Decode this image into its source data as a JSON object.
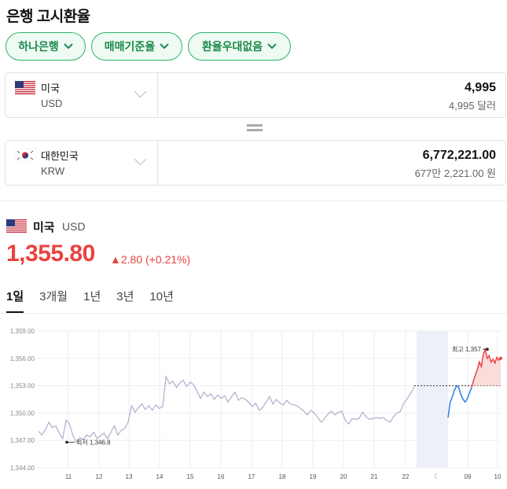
{
  "page": {
    "title": "은행 고시환율"
  },
  "filters": [
    {
      "label": "하나은행"
    },
    {
      "label": "매매기준율"
    },
    {
      "label": "환율우대없음"
    }
  ],
  "converter": {
    "from": {
      "name": "미국",
      "code": "USD",
      "amount": "4,995",
      "amount_text": "4,995 달러",
      "flag": "us-flag-icon"
    },
    "to": {
      "name": "대한민국",
      "code": "KRW",
      "amount": "6,772,221.00",
      "amount_text": "677만 2,221.00 원",
      "flag": "kr-flag-icon"
    }
  },
  "rate": {
    "country": "미국",
    "code": "USD",
    "price": "1,355.80",
    "change": "2.80 (+0.21%)",
    "up_color": "#e8423f"
  },
  "tabs": [
    {
      "label": "1일",
      "active": true
    },
    {
      "label": "3개월",
      "active": false
    },
    {
      "label": "1년",
      "active": false
    },
    {
      "label": "3년",
      "active": false
    },
    {
      "label": "10년",
      "active": false
    }
  ],
  "chart_data": {
    "type": "line",
    "ylim": [
      1344,
      1359
    ],
    "yticks": [
      "1,359.00",
      "1,356.00",
      "1,353.00",
      "1,350.00",
      "1,347.00",
      "1,344.00"
    ],
    "ytick_values": [
      1359,
      1356,
      1353,
      1350,
      1347,
      1344
    ],
    "xticks": [
      "11",
      "12",
      "13",
      "14",
      "15",
      "16",
      "17",
      "18",
      "19",
      "20",
      "21",
      "22",
      "09",
      "10"
    ],
    "baseline": 1353.0,
    "annotations": {
      "high": "최고 1,357",
      "low": "최저 1,346.8"
    },
    "series": [
      {
        "color": "#aab0cc",
        "values": [
          1348,
          1347.6,
          1348.2,
          1349,
          1348.4,
          1348.6,
          1347.8,
          1347.2,
          1349.2,
          1348.8,
          1347.5,
          1346.8,
          1347.3,
          1347.1,
          1347.6,
          1347.4,
          1347.9,
          1347.2,
          1347.5,
          1347.8,
          1347.2,
          1347.9,
          1348.6,
          1347.6,
          1348.1,
          1348.3,
          1349,
          1350.8,
          1350.1,
          1350.6,
          1351,
          1350.4,
          1350.8,
          1350.3,
          1350.9,
          1350.5,
          1350.7,
          1354,
          1353.2,
          1353.5,
          1352.8,
          1353.3,
          1353.6,
          1352.9,
          1353.4,
          1353.1,
          1352.4,
          1351.6,
          1352.3,
          1351.8,
          1352.1,
          1351.5,
          1352,
          1351.6,
          1351.9,
          1351.2,
          1351.8,
          1352.3,
          1351.4,
          1351.7,
          1351.5,
          1351.2,
          1350.7,
          1351.1,
          1350.3,
          1350.6,
          1351.2,
          1351.8,
          1351,
          1351.5,
          1351.1,
          1350.9,
          1351.4,
          1351,
          1350.9,
          1350.8,
          1350.5,
          1350.2,
          1349.8,
          1350.3,
          1350,
          1349.5,
          1349,
          1349.4,
          1349.9,
          1350.2,
          1349.8,
          1350.1,
          1350.2,
          1349.2,
          1348.8,
          1349.4,
          1349.3,
          1349.4,
          1350.1,
          1349.6,
          1349.3,
          1349.4,
          1349.5,
          1349.4,
          1349.5,
          1349.2,
          1349,
          1349.6,
          1350,
          1350.2,
          1351.1,
          1351.6,
          1352.2,
          1352.9
        ]
      },
      {
        "color": "#2b7de9",
        "values": [
          1349.5,
          1351.2,
          1351.8,
          1352.5,
          1353,
          1352.8,
          1352,
          1351.5,
          1351.2,
          1351.6,
          1352.2,
          1352.8
        ]
      },
      {
        "color": "#e8423f",
        "values": [
          1352.8,
          1353.6,
          1354.2,
          1354.8,
          1355.6,
          1355.1,
          1356.4,
          1357,
          1356,
          1356.3,
          1355.6,
          1355.9,
          1355.5,
          1356.1,
          1355.8,
          1356
        ]
      }
    ]
  }
}
